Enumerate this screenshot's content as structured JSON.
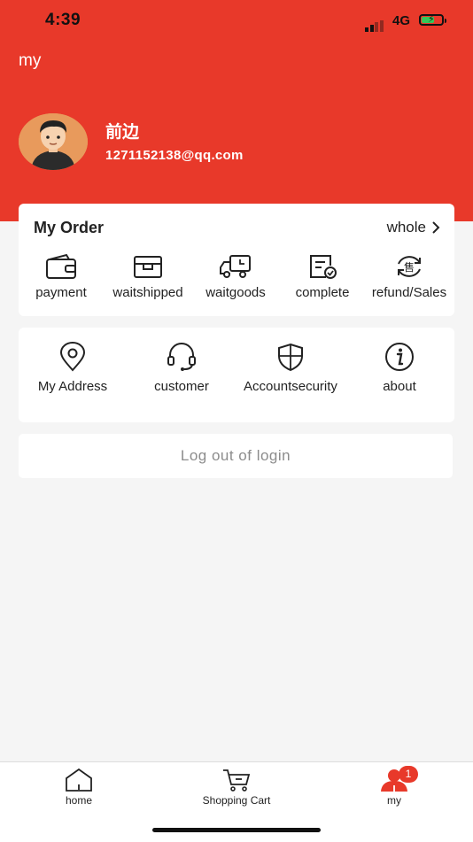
{
  "status_bar": {
    "time": "4:39",
    "network": "4G"
  },
  "header": {
    "title": "my",
    "user_name": "前边",
    "user_email": "1271152138@qq.com"
  },
  "orders": {
    "title": "My Order",
    "all_label": "whole",
    "items": [
      {
        "label": "payment",
        "icon": "wallet-icon"
      },
      {
        "label": "waitshipped",
        "icon": "box-icon"
      },
      {
        "label": "waitgoods",
        "icon": "truck-icon"
      },
      {
        "label": "complete",
        "icon": "check-doc-icon"
      },
      {
        "label": "refund/Sales",
        "icon": "after-sales-icon"
      }
    ]
  },
  "services": [
    {
      "label": "My Address",
      "icon": "location-icon"
    },
    {
      "label": "customer",
      "icon": "headset-icon"
    },
    {
      "label": "Accountsecurity",
      "icon": "shield-icon"
    },
    {
      "label": "about",
      "icon": "info-icon"
    }
  ],
  "logout_label": "Log out of login",
  "tabbar": {
    "items": [
      {
        "label": "home",
        "icon": "home-icon"
      },
      {
        "label": "Shopping Cart",
        "icon": "cart-icon"
      },
      {
        "label": "my",
        "icon": "user-icon"
      }
    ],
    "badge": "1"
  },
  "colors": {
    "brand_red": "#e8392a",
    "background": "#f5f5f5"
  }
}
